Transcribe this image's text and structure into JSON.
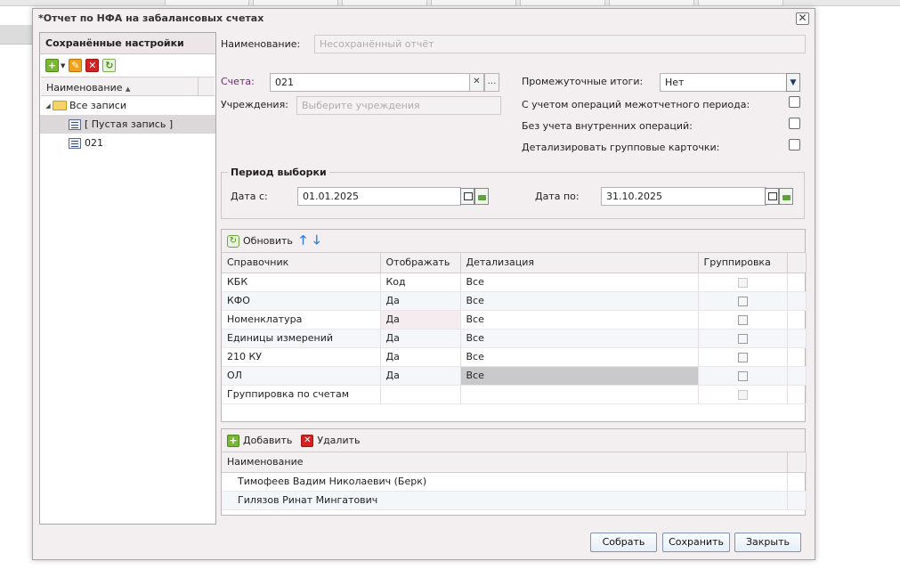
{
  "window": {
    "title": "*Отчет по НФА на забалансовых счетах"
  },
  "saved": {
    "title": "Сохранённые настройки",
    "column": "Наименование",
    "tree": {
      "root": "Все записи",
      "children": [
        "[ Пустая запись ]",
        "021"
      ]
    }
  },
  "form": {
    "name_label": "Наименование:",
    "name_placeholder": "Несохранённый отчёт",
    "accounts_label": "Счета:",
    "accounts_value": "021",
    "institutions_label": "Учреждения:",
    "institutions_placeholder": "Выберите учреждения",
    "subtotals_label": "Промежуточные итоги:",
    "subtotals_value": "Нет",
    "check_interperiod": "С учетом операций межотчетного периода:",
    "check_internal": "Без учета внутренних операций:",
    "check_detail": "Детализировать групповые карточки:"
  },
  "period": {
    "legend": "Период выборки",
    "from_label": "Дата с:",
    "from_value": "01.01.2025",
    "to_label": "Дата по:",
    "to_value": "31.10.2025"
  },
  "ref_grid": {
    "refresh_label": "Обновить",
    "columns": [
      "Справочник",
      "Отображать",
      "Детализация",
      "Группировка"
    ],
    "rows": [
      {
        "name": "КБК",
        "show": "Код",
        "detail": "Все"
      },
      {
        "name": "КФО",
        "show": "Да",
        "detail": "Все"
      },
      {
        "name": "Номенклатура",
        "show": "Да",
        "detail": "Все"
      },
      {
        "name": "Единицы измерений",
        "show": "Да",
        "detail": "Все"
      },
      {
        "name": "210 КУ",
        "show": "Да",
        "detail": "Все"
      },
      {
        "name": "ОЛ",
        "show": "Да",
        "detail": "Все"
      },
      {
        "name": "Группировка по счетам",
        "show": "",
        "detail": ""
      }
    ]
  },
  "people_grid": {
    "add_label": "Добавить",
    "delete_label": "Удалить",
    "column": "Наименование",
    "rows": [
      "Тимофеев Вадим Николаевич (Берк)",
      "Гилязов Ринат Мингатович"
    ]
  },
  "buttons": {
    "collect": "Собрать",
    "save": "Сохранить",
    "close": "Закрыть"
  }
}
